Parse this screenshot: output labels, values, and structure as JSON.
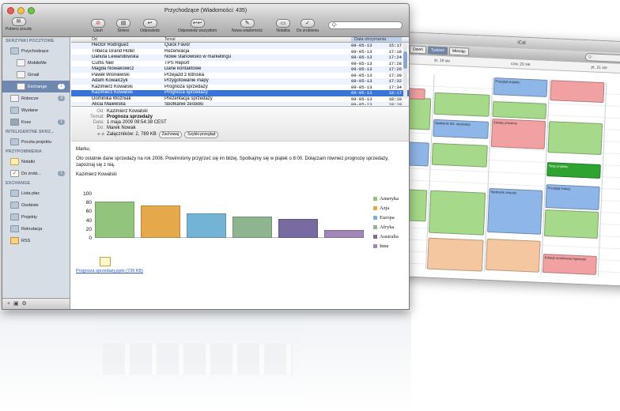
{
  "window": {
    "title": "Przychodzące (Wiadomości: 435)"
  },
  "toolbar": {
    "fetch": "Pobierz pocztę",
    "delete": "Usuń",
    "junk": "Śmieci",
    "reply": "Odpowiedz",
    "reply_all": "Odpowiedz wszystkim",
    "new_message": "Nowa wiadomość",
    "note": "Notatka",
    "todo": "Do zrobienia",
    "search_placeholder": "Q-"
  },
  "sidebar": {
    "mailboxes_header": "SKRZYNKI POCZTOWE",
    "items": [
      {
        "label": "Przychodzące",
        "badge": ""
      },
      {
        "label": "MobileMe",
        "badge": ""
      },
      {
        "label": "Gmail",
        "badge": ""
      },
      {
        "label": "Exchange",
        "badge": "1"
      },
      {
        "label": "Robocze",
        "badge": "3"
      },
      {
        "label": "Wysłane",
        "badge": ""
      },
      {
        "label": "Kosz",
        "badge": "1"
      }
    ],
    "smart_header": "INTELIGENTNE SKRZ...",
    "smart_items": [
      {
        "label": "Poczta projektu"
      }
    ],
    "reminders_header": "PRZYPOMNIENIA",
    "reminder_items": [
      {
        "label": "Notatki"
      },
      {
        "label": "Do zrobi...",
        "badge": "1"
      }
    ],
    "exchange_header": "EXCHANGE",
    "exchange_items": [
      {
        "label": "Lista płac"
      },
      {
        "label": "Osobiste"
      },
      {
        "label": "Projekty"
      },
      {
        "label": "Rekrutacja"
      },
      {
        "label": "RSS"
      }
    ]
  },
  "list": {
    "headers": {
      "from": "Od",
      "subject": "Temat",
      "date": "Data otrzymania",
      "search": "Szukaj"
    },
    "rows": [
      {
        "from": "Hector Rodriguez",
        "subject": "Quick Favor",
        "date": "09-05-13",
        "time": "15:17"
      },
      {
        "from": "Tribeca Grand Hotel",
        "subject": "Rezerwacja",
        "date": "09-05-13",
        "time": "17:18"
      },
      {
        "from": "Danuta Lewandowska",
        "subject": "Nowe stanowisko w marketingu",
        "date": "09-05-13",
        "time": "17:24"
      },
      {
        "from": "Curtis Neil",
        "subject": "TPS Report",
        "date": "09-05-13",
        "time": "17:28"
      },
      {
        "from": "Magda Nowakowicz",
        "subject": "Dane kontaktowe",
        "date": "09-05-13",
        "time": "17:26"
      },
      {
        "from": "Paweł Wiśniewski",
        "subject": "Przejazd z lotniska",
        "date": "09-05-13",
        "time": "17:30"
      },
      {
        "from": "Adam Kowalczyk",
        "subject": "Przygotowanie mapy",
        "date": "09-05-13",
        "time": "17:32"
      },
      {
        "from": "Kazimierz Kowalski",
        "subject": "Prognoza sprzedaży",
        "date": "09-05-13",
        "time": "17:34"
      },
      {
        "from": "Kazimierz Kowalski",
        "subject": "Prognoza sprzedaży",
        "date": "09-05-13",
        "time": "18:17"
      },
      {
        "from": "Dominika Woźniak",
        "subject": "Prezentacja sprzedaży",
        "date": "09-05-13",
        "time": "18:19"
      },
      {
        "from": "Alicja Majewska",
        "subject": "Spotkanie zespołu",
        "date": "09-05-13",
        "time": "18:19"
      }
    ],
    "selected_index": 8
  },
  "message": {
    "from_k": "Od:",
    "from": "Kazimierz Kowalski",
    "subject_k": "Temat:",
    "subject": "Prognoza sprzedaży",
    "date_k": "Data:",
    "date": "1 maja 2009 09:54:38 CEST",
    "to_k": "Do:",
    "to": "Marek Nowak",
    "attach_k": "Załączników: 2, 789 KB",
    "save_btn": "Zachowaj",
    "quicklook_btn": "Szybki przegląd",
    "greeting": "Marku,",
    "body": "Oto ostatnie dane sprzedaży na rok 2008. Powinniśmy przyjrzeć się im bliżej. Spotkajmy się w piątek o 8:00. Dołączam również prognozę sprzedaży, zapoznaj się z nią.",
    "signature": "Kazimierz Kowalski",
    "attachment": "Prognoza sprzedaży.pptx (739 KB)"
  },
  "chart_data": {
    "type": "bar",
    "categories": [
      "Ameryka",
      "Azja",
      "Europa",
      "Afryka",
      "Australia",
      "Inne"
    ],
    "values": [
      82,
      74,
      56,
      49,
      42,
      18
    ],
    "yticks": [
      100,
      80,
      60,
      40,
      20,
      0
    ],
    "ylim": [
      0,
      100
    ],
    "colors": [
      "#93c47d",
      "#e5a84b",
      "#73b4d6",
      "#8fb58f",
      "#7a6aa2",
      "#a386b8"
    ],
    "legend_position": "right"
  },
  "ical": {
    "title": "iCal",
    "tabs": [
      "Dzień",
      "Tydzień",
      "Miesiąc"
    ],
    "search": "Q-",
    "days": [
      "śr, 19 sie",
      "czw, 20 sie",
      "pt, 21 sie"
    ],
    "events": [
      {
        "label": "Przegląd projektu",
        "cls": "b"
      },
      {
        "label": "Spotkanie dot. sprzedaży",
        "cls": "b"
      },
      {
        "label": "Spotkanie zespołu",
        "cls": "b"
      },
      {
        "label": "Zakupy prezentu",
        "cls": "r"
      },
      {
        "label": "Przegląd funkcji",
        "cls": "b"
      },
      {
        "label": "Kolacja urodzinowa Agnieszki",
        "cls": "r"
      },
      {
        "label": "Testy projektu",
        "cls": "dg"
      }
    ]
  }
}
